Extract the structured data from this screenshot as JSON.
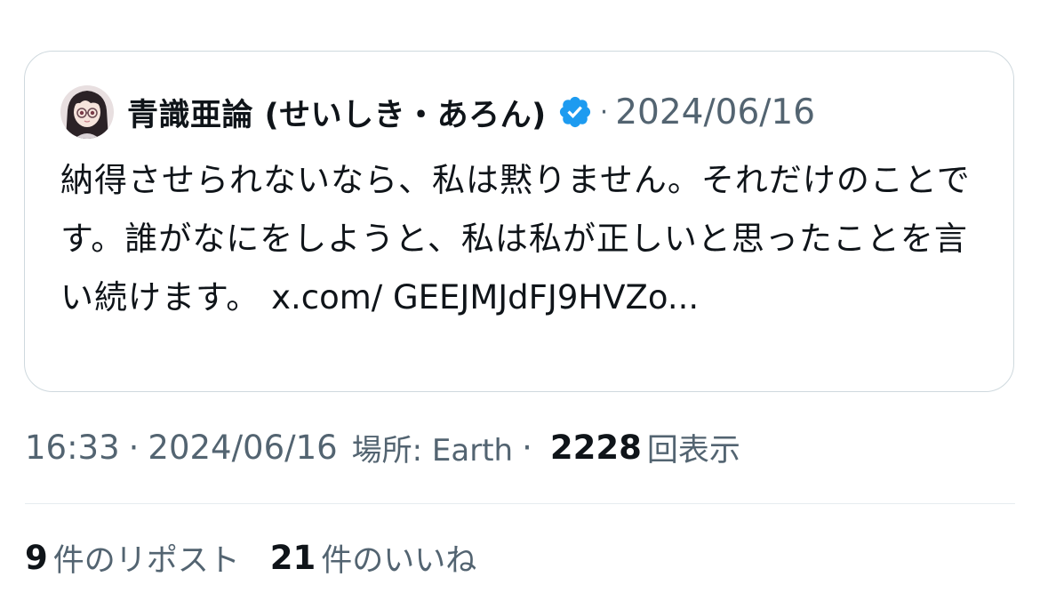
{
  "quoted_tweet": {
    "author_name": "青識亜論 (せいしき・あろん)",
    "verified": true,
    "separator": "·",
    "date": "2024/06/16",
    "text": "納得させられないなら、私は黙りません。それだけのことです。誰がなにをしようと、私は私が正しいと思ったことを言い続けます。",
    "link_text": "x.com/ GEEJMJdFJ9HVZo...",
    "badge_color": "#1d9bf0"
  },
  "meta": {
    "time": "16:33",
    "separator": "·",
    "date": "2024/06/16",
    "place": "場所: Earth",
    "separator2": "·",
    "views_count": "2228",
    "views_label": "回表示"
  },
  "stats": {
    "reposts_count": "9",
    "reposts_label": "件のリポスト",
    "likes_count": "21",
    "likes_label": "件のいいね"
  },
  "colors": {
    "text": "#0f1419",
    "secondary": "#536471",
    "border": "#cfd9de",
    "verified": "#1d9bf0"
  }
}
